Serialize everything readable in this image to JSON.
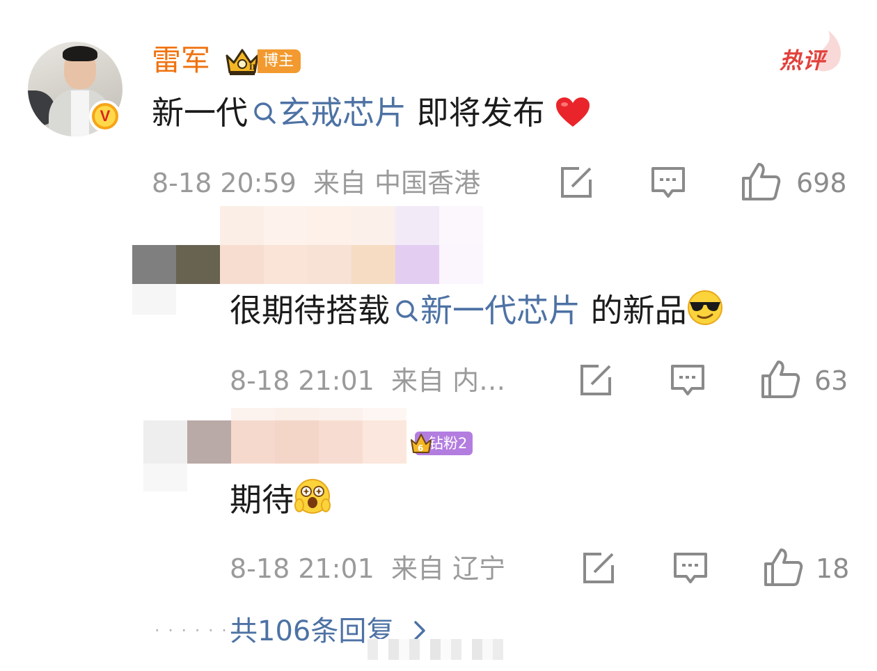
{
  "main_comment": {
    "author": "雷军",
    "badge_label": "博主",
    "hot_label": "热评",
    "text_before": "新一代",
    "topic": "玄戒芯片",
    "text_after": "即将发布",
    "time": "8-18 20:59",
    "location": "来自 中国香港",
    "like_count": "698",
    "icons": [
      "edit-share-icon",
      "comment-icon",
      "like-icon",
      "heart-emoji"
    ]
  },
  "replies": [
    {
      "text_before": "很期待搭载",
      "topic": "新一代芯片",
      "text_after": "的新品",
      "time": "8-18 21:01",
      "location": "来自 内…",
      "like_count": "63",
      "emoji": "sunglasses-emoji"
    },
    {
      "badge_label": "钻粉2",
      "text": "期待",
      "time": "8-18 21:01",
      "location": "来自 辽宁",
      "like_count": "18",
      "emoji": "starstruck-emoji"
    }
  ],
  "more_replies_label": "共106条回复",
  "colors": {
    "author_orange": "#f0720f",
    "topic_blue": "#4d72a4",
    "meta_gray": "#9a9a9a",
    "hot_red": "#e2413b",
    "diamond_purple": "#b37de0"
  }
}
